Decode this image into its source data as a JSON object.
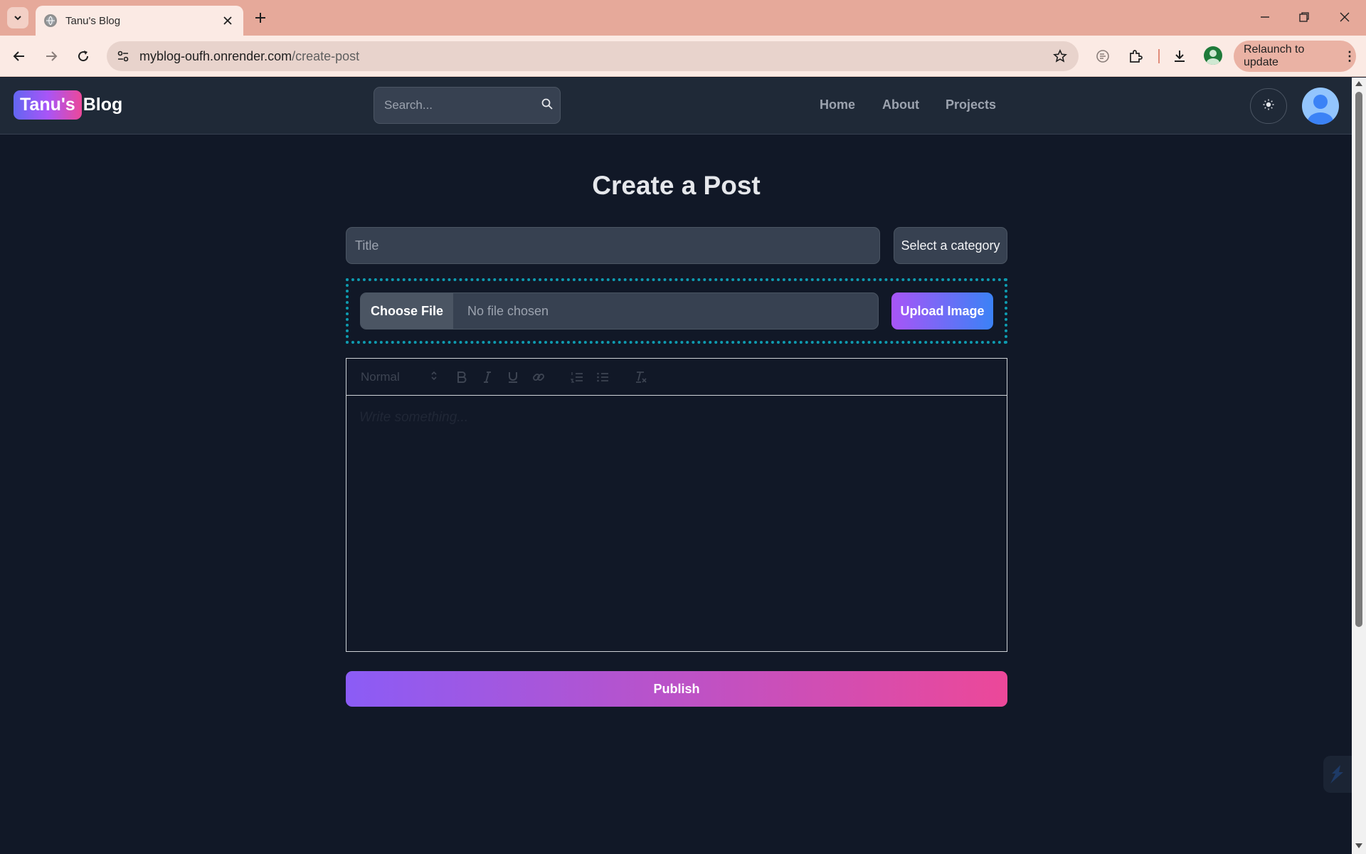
{
  "browser": {
    "tab_title": "Tanu's Blog",
    "url_host": "myblog-oufh.onrender.com",
    "url_path": "/create-post",
    "relaunch_label": "Relaunch to update"
  },
  "header": {
    "logo_badge": "Tanu's",
    "logo_text": "Blog",
    "search_placeholder": "Search...",
    "nav": [
      {
        "label": "Home"
      },
      {
        "label": "About"
      },
      {
        "label": "Projects"
      }
    ]
  },
  "form": {
    "heading": "Create a Post",
    "title_placeholder": "Title",
    "category_label": "Select a category",
    "choose_file_label": "Choose File",
    "no_file_label": "No file chosen",
    "upload_label": "Upload Image",
    "editor": {
      "header_select": "Normal",
      "placeholder": "Write something..."
    },
    "publish_label": "Publish"
  },
  "colors": {
    "page_bg": "#111827",
    "header_bg": "#1f2937",
    "upload_border": "#0e9bb0",
    "publish_from": "#8b5cf6",
    "publish_to": "#ec4899"
  },
  "icons": [
    "tab-search-icon",
    "globe-icon",
    "close-icon",
    "plus-icon",
    "minimize-icon",
    "restore-icon",
    "window-close-icon",
    "back-icon",
    "forward-icon",
    "reload-icon",
    "site-info-icon",
    "star-icon",
    "extension-puzzle-icon",
    "download-icon",
    "search-icon",
    "sun-icon",
    "user-avatar-icon",
    "bold-icon",
    "italic-icon",
    "underline-icon",
    "link-icon",
    "ordered-list-icon",
    "bullet-list-icon",
    "clean-format-icon"
  ]
}
